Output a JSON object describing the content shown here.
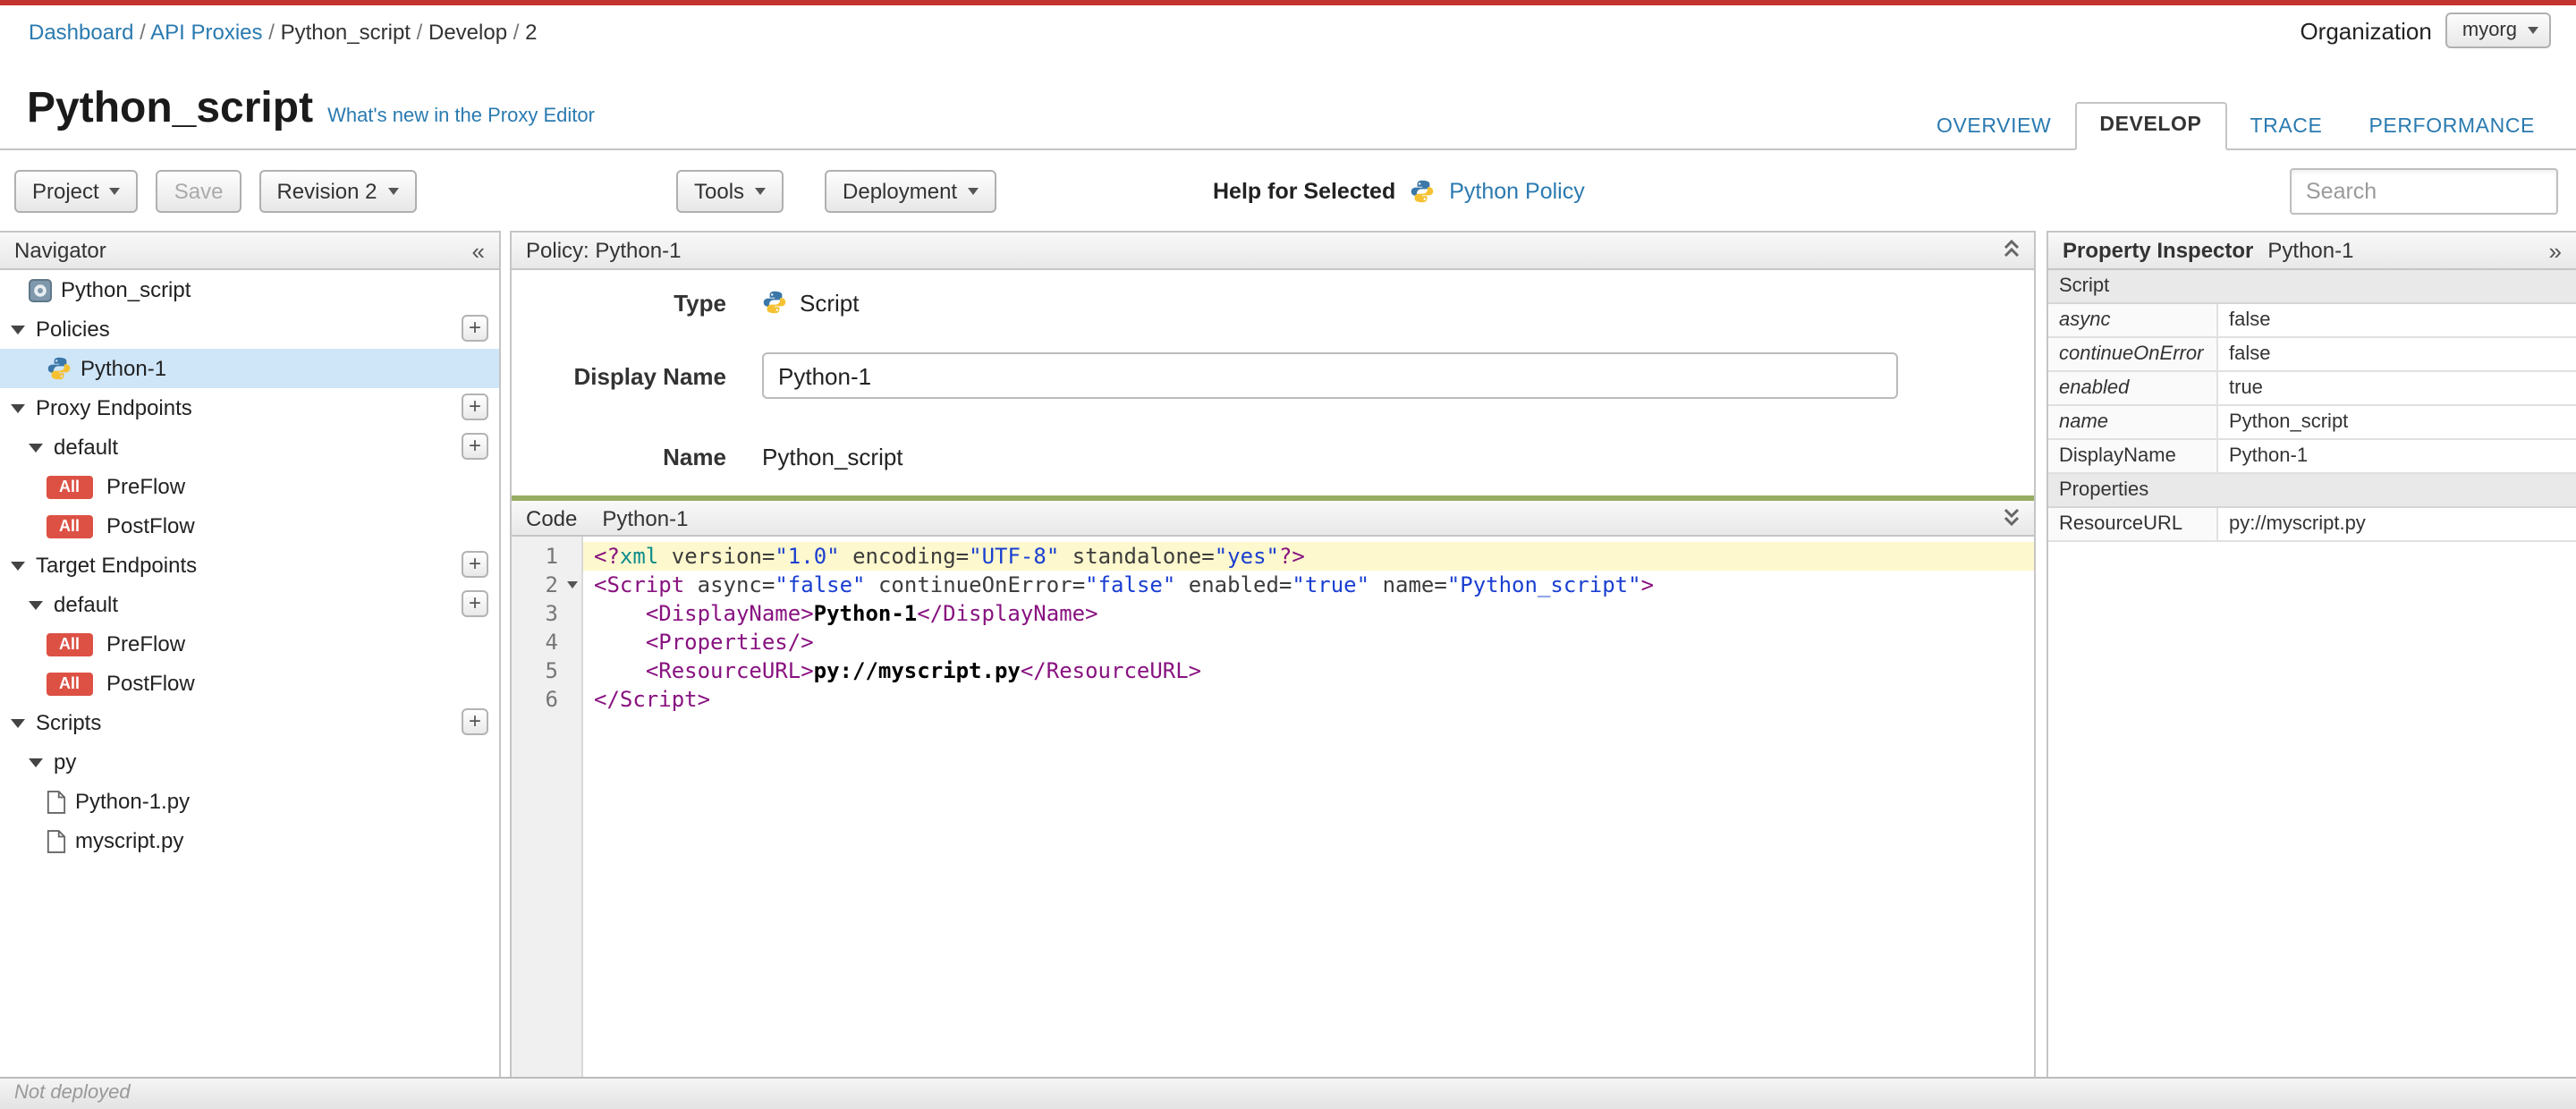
{
  "page": {
    "accent_red": "#c4342f",
    "link_color": "#2a7ab0",
    "selected_row_bg": "#cfe6f8",
    "badge_color": "#dd5145"
  },
  "breadcrumb": {
    "separator": "/",
    "items": [
      {
        "label": "Dashboard",
        "link": true
      },
      {
        "label": "API Proxies",
        "link": true
      },
      {
        "label": "Python_script",
        "link": false
      },
      {
        "label": "Develop",
        "link": false
      },
      {
        "label": "2",
        "link": false
      }
    ]
  },
  "organization": {
    "label": "Organization",
    "value": "myorg"
  },
  "header": {
    "title": "Python_script",
    "whats_new_link": "What's new in the Proxy Editor"
  },
  "tabs": [
    {
      "label": "OVERVIEW",
      "active": false
    },
    {
      "label": "DEVELOP",
      "active": true
    },
    {
      "label": "TRACE",
      "active": false
    },
    {
      "label": "PERFORMANCE",
      "active": false
    }
  ],
  "toolbar": {
    "project_label": "Project",
    "save_label": "Save",
    "revision_label": "Revision 2",
    "tools_label": "Tools",
    "deployment_label": "Deployment",
    "help_for_selected_label": "Help for Selected",
    "policy_help_link": "Python Policy",
    "search_placeholder": "Search"
  },
  "navigator": {
    "title": "Navigator",
    "collapse_glyph": "«",
    "items": [
      {
        "label": "Python_script",
        "indent": 1,
        "icon": "proxy"
      },
      {
        "label": "Policies",
        "indent": 0,
        "twisty": true,
        "add": true
      },
      {
        "label": "Python-1",
        "indent": 2,
        "icon": "python",
        "selected": true
      },
      {
        "label": "Proxy Endpoints",
        "indent": 0,
        "twisty": true,
        "add": true
      },
      {
        "label": "default",
        "indent": 1,
        "twisty": true,
        "add": true
      },
      {
        "label": "PreFlow",
        "indent": 2,
        "badge": "All"
      },
      {
        "label": "PostFlow",
        "indent": 2,
        "badge": "All"
      },
      {
        "label": "Target Endpoints",
        "indent": 0,
        "twisty": true,
        "add": true
      },
      {
        "label": "default",
        "indent": 1,
        "twisty": true,
        "add": true
      },
      {
        "label": "PreFlow",
        "indent": 2,
        "badge": "All"
      },
      {
        "label": "PostFlow",
        "indent": 2,
        "badge": "All"
      },
      {
        "label": "Scripts",
        "indent": 0,
        "twisty": true,
        "add": true
      },
      {
        "label": "py",
        "indent": 1,
        "twisty": true
      },
      {
        "label": "Python-1.py",
        "indent": 2,
        "icon": "file"
      },
      {
        "label": "myscript.py",
        "indent": 2,
        "icon": "file"
      }
    ]
  },
  "policy_panel": {
    "header": "Policy: Python-1",
    "type_label": "Type",
    "type_value": "Script",
    "display_name_label": "Display Name",
    "display_name_value": "Python-1",
    "name_label": "Name",
    "name_value": "Python_script"
  },
  "code_panel": {
    "tab_label": "Code",
    "title": "Python-1",
    "active_line": 1,
    "fold_lines": [
      2
    ],
    "lines": [
      [
        {
          "t": "<?",
          "c": "pi"
        },
        {
          "t": "xml",
          "c": "pin"
        },
        {
          "t": " ",
          "c": "pl"
        },
        {
          "t": "version=",
          "c": "attr"
        },
        {
          "t": "\"1.0\"",
          "c": "str"
        },
        {
          "t": " ",
          "c": "pl"
        },
        {
          "t": "encoding=",
          "c": "attr"
        },
        {
          "t": "\"UTF-8\"",
          "c": "str"
        },
        {
          "t": " ",
          "c": "pl"
        },
        {
          "t": "standalone=",
          "c": "attr"
        },
        {
          "t": "\"yes\"",
          "c": "str"
        },
        {
          "t": "?>",
          "c": "pi"
        }
      ],
      [
        {
          "t": "<Script",
          "c": "tag"
        },
        {
          "t": " ",
          "c": "pl"
        },
        {
          "t": "async=",
          "c": "attr"
        },
        {
          "t": "\"false\"",
          "c": "str"
        },
        {
          "t": " ",
          "c": "pl"
        },
        {
          "t": "continueOnError=",
          "c": "attr"
        },
        {
          "t": "\"false\"",
          "c": "str"
        },
        {
          "t": " ",
          "c": "pl"
        },
        {
          "t": "enabled=",
          "c": "attr"
        },
        {
          "t": "\"true\"",
          "c": "str"
        },
        {
          "t": " ",
          "c": "pl"
        },
        {
          "t": "name=",
          "c": "attr"
        },
        {
          "t": "\"Python_script\"",
          "c": "str"
        },
        {
          "t": ">",
          "c": "tag"
        }
      ],
      [
        {
          "t": "    ",
          "c": "pl"
        },
        {
          "t": "<DisplayName>",
          "c": "tag"
        },
        {
          "t": "Python-1",
          "c": "txt"
        },
        {
          "t": "</DisplayName>",
          "c": "tag"
        }
      ],
      [
        {
          "t": "    ",
          "c": "pl"
        },
        {
          "t": "<Properties/>",
          "c": "tag"
        }
      ],
      [
        {
          "t": "    ",
          "c": "pl"
        },
        {
          "t": "<ResourceURL>",
          "c": "tag"
        },
        {
          "t": "py://myscript.py",
          "c": "txt"
        },
        {
          "t": "</ResourceURL>",
          "c": "tag"
        }
      ],
      [
        {
          "t": "</Script>",
          "c": "tag"
        }
      ]
    ]
  },
  "inspector": {
    "title": "Property Inspector",
    "subtitle": "Python-1",
    "expand_glyph": "»",
    "rows": [
      {
        "type": "section",
        "name": "Script"
      },
      {
        "type": "prop",
        "name": "async",
        "value": "false",
        "italic": true
      },
      {
        "type": "prop",
        "name": "continueOnError",
        "value": "false",
        "italic": true
      },
      {
        "type": "prop",
        "name": "enabled",
        "value": "true",
        "italic": true
      },
      {
        "type": "prop",
        "name": "name",
        "value": "Python_script",
        "italic": true
      },
      {
        "type": "prop",
        "name": "DisplayName",
        "value": "Python-1",
        "italic": false
      },
      {
        "type": "section",
        "name": "Properties"
      },
      {
        "type": "prop",
        "name": "ResourceURL",
        "value": "py://myscript.py",
        "italic": false
      }
    ]
  },
  "statusbar": {
    "text": "Not deployed"
  }
}
